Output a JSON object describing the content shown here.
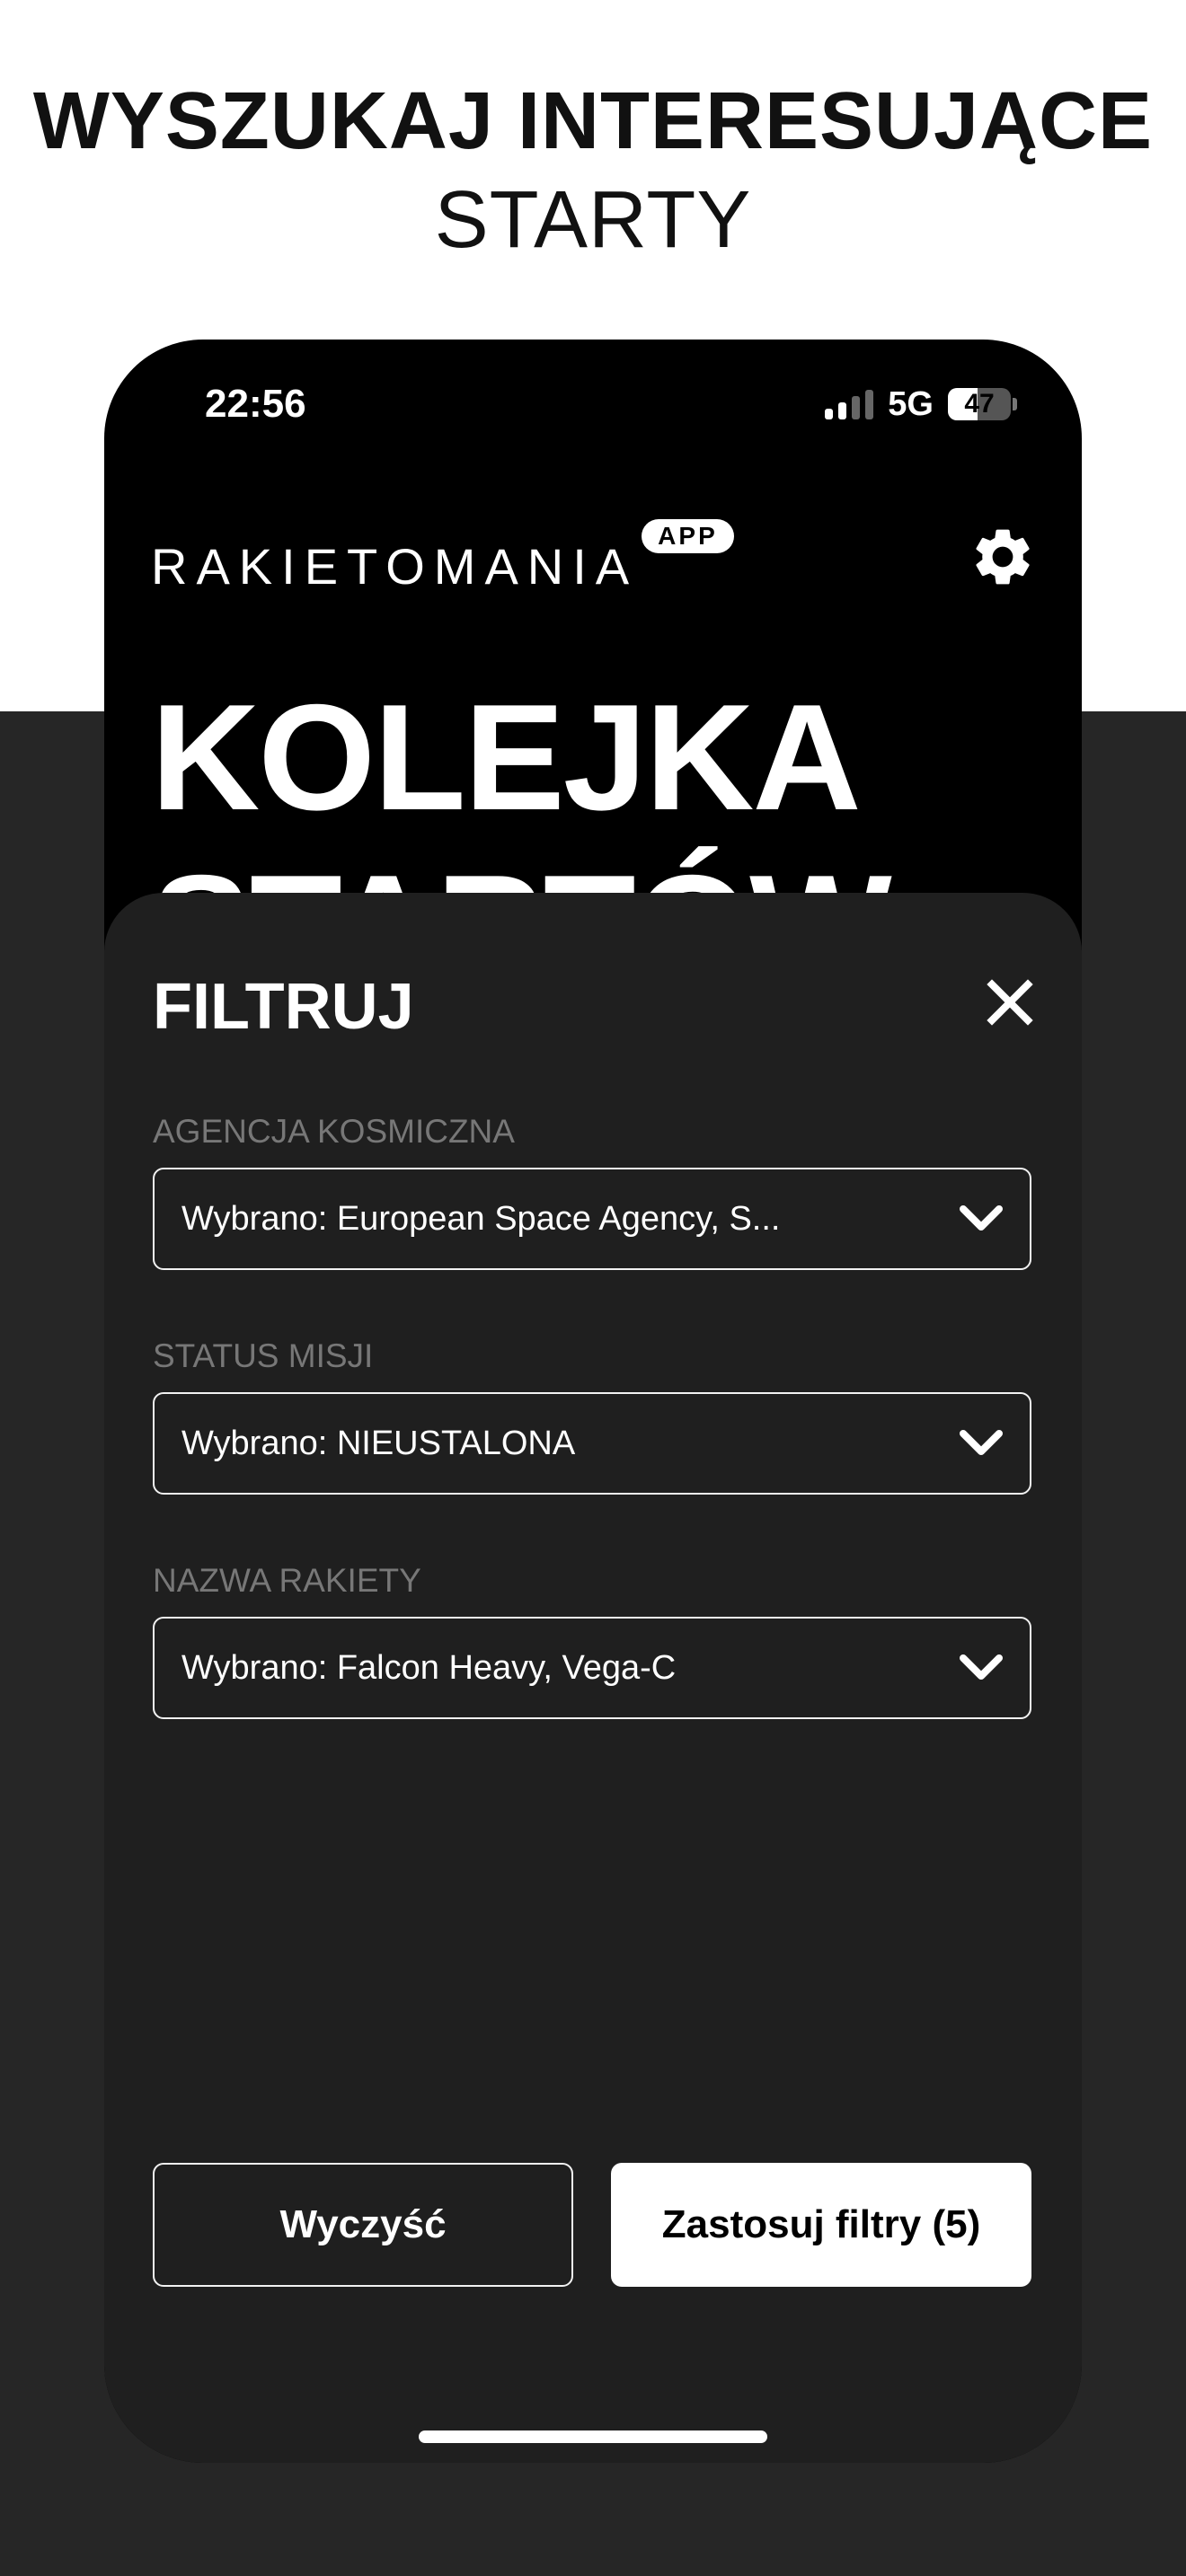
{
  "promo": {
    "headline_bold": "WYSZUKAJ INTERESUJĄCE",
    "headline_light": "STARTY"
  },
  "status_bar": {
    "time": "22:56",
    "network": "5G",
    "battery": "47",
    "battery_level": 0.47
  },
  "app": {
    "logo_text": "RAKIETOMANIA",
    "logo_badge": "APP",
    "page_title": "KOLEJKA STARTÓW"
  },
  "filter_sheet": {
    "title": "FILTRUJ",
    "filters": [
      {
        "label": "AGENCJA KOSMICZNA",
        "value": "Wybrano: European Space Agency, S..."
      },
      {
        "label": "STATUS MISJI",
        "value": "Wybrano: NIEUSTALONA"
      },
      {
        "label": "NAZWA RAKIETY",
        "value": "Wybrano: Falcon Heavy, Vega-C"
      }
    ],
    "clear_label": "Wyczyść",
    "apply_label": "Zastosuj filtry (5)"
  },
  "icons": {
    "settings": "gear-icon",
    "close": "close-icon",
    "dropdown": "chevron-down-icon"
  },
  "colors": {
    "sheet_bg": "#1f1f1f",
    "page_dark_bg": "#262626",
    "label_gray": "#777777",
    "accent_white": "#ffffff"
  }
}
